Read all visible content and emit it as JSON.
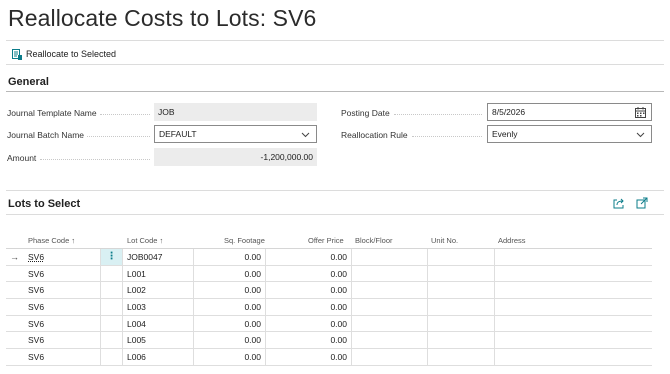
{
  "page": {
    "title": "Reallocate Costs to Lots: SV6"
  },
  "actions": {
    "reallocate_label": "Reallocate to Selected"
  },
  "general": {
    "section_title": "General",
    "journal_template_name": {
      "label": "Journal Template Name",
      "value": "JOB"
    },
    "journal_batch_name": {
      "label": "Journal Batch Name",
      "value": "DEFAULT"
    },
    "amount": {
      "label": "Amount",
      "value": "-1,200,000.00"
    },
    "posting_date": {
      "label": "Posting Date",
      "value": "8/5/2026"
    },
    "reallocation_rule": {
      "label": "Reallocation Rule",
      "value": "Evenly"
    }
  },
  "lots": {
    "section_title": "Lots to Select",
    "columns": {
      "phase_code": "Phase Code",
      "lot_code": "Lot Code",
      "sq_footage": "Sq. Footage",
      "offer_price": "Offer Price",
      "block_floor": "Block/Floor",
      "unit_no": "Unit No.",
      "address": "Address"
    },
    "rows": [
      {
        "phase": "SV6",
        "lot": "JOB0047",
        "sq": "0.00",
        "offer": "0.00"
      },
      {
        "phase": "SV6",
        "lot": "L001",
        "sq": "0.00",
        "offer": "0.00"
      },
      {
        "phase": "SV6",
        "lot": "L002",
        "sq": "0.00",
        "offer": "0.00"
      },
      {
        "phase": "SV6",
        "lot": "L003",
        "sq": "0.00",
        "offer": "0.00"
      },
      {
        "phase": "SV6",
        "lot": "L004",
        "sq": "0.00",
        "offer": "0.00"
      },
      {
        "phase": "SV6",
        "lot": "L005",
        "sq": "0.00",
        "offer": "0.00"
      },
      {
        "phase": "SV6",
        "lot": "L006",
        "sq": "0.00",
        "offer": "0.00"
      }
    ]
  },
  "colors": {
    "accent": "#0b7c8a",
    "selected_cell": "#d9f0f3",
    "readonly_bg": "#ececec"
  }
}
